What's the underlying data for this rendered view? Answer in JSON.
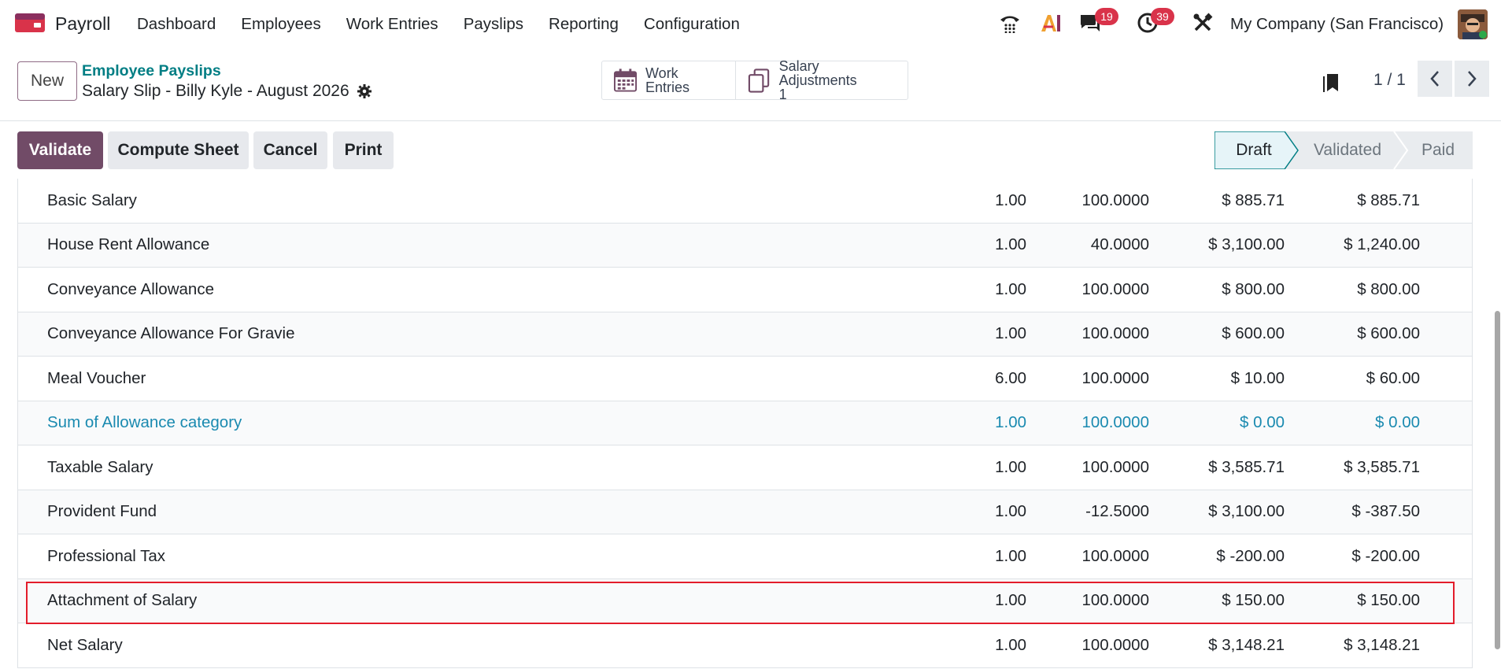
{
  "navbar": {
    "app_name": "Payroll",
    "menu": [
      "Dashboard",
      "Employees",
      "Work Entries",
      "Payslips",
      "Reporting",
      "Configuration"
    ],
    "messages_badge": "19",
    "activities_badge": "39",
    "company": "My Company (San Francisco)",
    "icons": [
      "phone-icon",
      "ai-icon",
      "chat-icon",
      "clock-icon",
      "tools-icon"
    ]
  },
  "control": {
    "new_label": "New",
    "breadcrumb": "Employee Payslips",
    "record_title": "Salary Slip - Billy Kyle - August 2026",
    "smart_buttons": {
      "work_entries": "Work Entries",
      "salary_adjustments": "Salary Adjustments",
      "salary_adjustments_count": "1"
    },
    "pager": "1 / 1"
  },
  "actions": {
    "validate": "Validate",
    "compute": "Compute Sheet",
    "cancel": "Cancel",
    "print": "Print"
  },
  "stages": {
    "draft": "Draft",
    "validated": "Validated",
    "paid": "Paid",
    "current": "Draft"
  },
  "lines": [
    {
      "name": "Basic Salary",
      "qty": "1.00",
      "rate": "100.0000",
      "amount": "$ 885.71",
      "total": "$ 885.71"
    },
    {
      "name": "House Rent Allowance",
      "qty": "1.00",
      "rate": "40.0000",
      "amount": "$ 3,100.00",
      "total": "$ 1,240.00"
    },
    {
      "name": "Conveyance Allowance",
      "qty": "1.00",
      "rate": "100.0000",
      "amount": "$ 800.00",
      "total": "$ 800.00"
    },
    {
      "name": "Conveyance Allowance For Gravie",
      "qty": "1.00",
      "rate": "100.0000",
      "amount": "$ 600.00",
      "total": "$ 600.00"
    },
    {
      "name": "Meal Voucher",
      "qty": "6.00",
      "rate": "100.0000",
      "amount": "$ 10.00",
      "total": "$ 60.00"
    },
    {
      "name": "Sum of Allowance category",
      "qty": "1.00",
      "rate": "100.0000",
      "amount": "$ 0.00",
      "total": "$ 0.00"
    },
    {
      "name": "Taxable Salary",
      "qty": "1.00",
      "rate": "100.0000",
      "amount": "$ 3,585.71",
      "total": "$ 3,585.71"
    },
    {
      "name": "Provident Fund",
      "qty": "1.00",
      "rate": "-12.5000",
      "amount": "$ 3,100.00",
      "total": "$ -387.50"
    },
    {
      "name": "Professional Tax",
      "qty": "1.00",
      "rate": "100.0000",
      "amount": "$ -200.00",
      "total": "$ -200.00"
    },
    {
      "name": "Attachment of Salary",
      "qty": "1.00",
      "rate": "100.0000",
      "amount": "$ 150.00",
      "total": "$ 150.00"
    },
    {
      "name": "Net Salary",
      "qty": "1.00",
      "rate": "100.0000",
      "amount": "$ 3,148.21",
      "total": "$ 3,148.21"
    }
  ],
  "colors": {
    "brand": "#714b67",
    "link": "#017e84",
    "category_row": "#1a8ab0",
    "badge": "#d9334a",
    "highlight": "#e31c2b"
  }
}
